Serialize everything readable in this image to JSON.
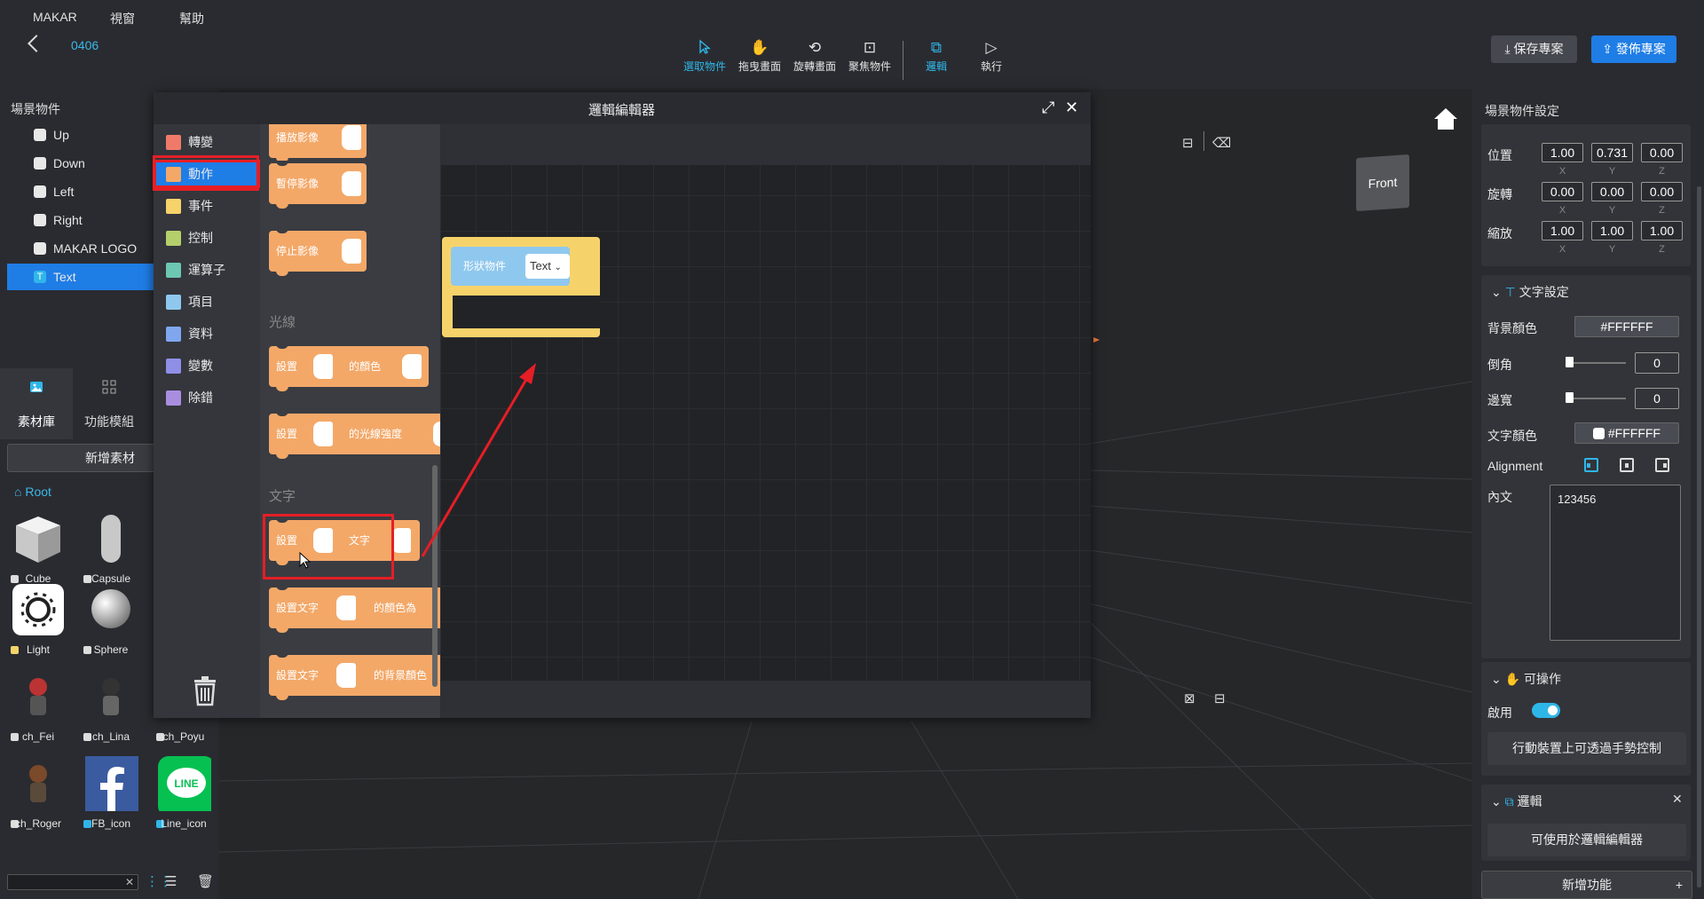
{
  "menu": [
    "MAKAR",
    "視窗",
    "幫助"
  ],
  "project_name": "0406",
  "toolbar": {
    "tools": [
      {
        "label": "選取物件",
        "icon": "cursor-icon",
        "active": true
      },
      {
        "label": "拖曳畫面",
        "icon": "hand-icon",
        "active": false
      },
      {
        "label": "旋轉畫面",
        "icon": "rotate-icon",
        "active": false
      },
      {
        "label": "聚焦物件",
        "icon": "focus-icon",
        "active": false
      },
      {
        "label": "邏輯",
        "icon": "logic-icon",
        "active": true
      },
      {
        "label": "執行",
        "icon": "play-icon",
        "active": false
      }
    ],
    "save_label": "保存專案",
    "publish_label": "發佈專案"
  },
  "scene": {
    "title": "場景物件",
    "items": [
      {
        "label": "Up"
      },
      {
        "label": "Down"
      },
      {
        "label": "Left"
      },
      {
        "label": "Right"
      },
      {
        "label": "MAKAR LOGO"
      },
      {
        "label": "Text",
        "selected": true
      }
    ],
    "tabs": [
      "素材庫",
      "功能模組"
    ],
    "add_asset": "新增素材",
    "root_label": "Root",
    "assets": [
      {
        "label": "Cube"
      },
      {
        "label": "Capsule"
      },
      {
        "label": "Light"
      },
      {
        "label": "Sphere"
      },
      {
        "label": "ch_Fei"
      },
      {
        "label": "ch_Lina"
      },
      {
        "label": "ch_Poyu"
      },
      {
        "label": "ch_Roger"
      },
      {
        "label": "FB_icon"
      },
      {
        "label": "Line_icon"
      }
    ]
  },
  "viewport": {
    "cube_label": "Front"
  },
  "logic_editor": {
    "title": "邏輯編輯器",
    "categories": [
      {
        "label": "轉變",
        "color": "#f07a6a"
      },
      {
        "label": "動作",
        "color": "#f3a868",
        "selected": true
      },
      {
        "label": "事件",
        "color": "#f6d36a"
      },
      {
        "label": "控制",
        "color": "#b5cf6b"
      },
      {
        "label": "運算子",
        "color": "#6cc7b3"
      },
      {
        "label": "項目",
        "color": "#8fc8ee"
      },
      {
        "label": "資料",
        "color": "#7fa6ee"
      },
      {
        "label": "變數",
        "color": "#8f8fe8"
      },
      {
        "label": "除錯",
        "color": "#a98ee0"
      }
    ],
    "blocks": {
      "play_video": "播放影像",
      "pause_video": "暫停影像",
      "stop_video": "停止影像",
      "light_section": "光線",
      "set_color_a": "設置",
      "set_color_b": "的顏色",
      "set_intensity_a": "設置",
      "set_intensity_b": "的光線強度",
      "text_section": "文字",
      "set_text_a": "設置",
      "set_text_b": "文字",
      "set_text_color_a": "設置文字",
      "set_text_color_b": "的顏色為",
      "set_text_bg_a": "設置文字",
      "set_text_bg_b": "的背景顏色"
    },
    "workspace_block": {
      "label": "形狀物件",
      "select_value": "Text"
    }
  },
  "props": {
    "title": "場景物件設定",
    "position_label": "位置",
    "rotation_label": "旋轉",
    "scale_label": "縮放",
    "position": [
      "1.00",
      "0.731",
      "0.00"
    ],
    "rotation": [
      "0.00",
      "0.00",
      "0.00"
    ],
    "scale": [
      "1.00",
      "1.00",
      "1.00"
    ],
    "axes": [
      "X",
      "Y",
      "Z"
    ],
    "text_settings": {
      "header": "文字設定",
      "bg_color_label": "背景顏色",
      "bg_color": "#FFFFFF",
      "radius_label": "倒角",
      "radius": "0",
      "border_label": "邊寬",
      "border": "0",
      "text_color_label": "文字顏色",
      "text_color": "#FFFFFF",
      "alignment_label": "Alignment",
      "content_label": "內文",
      "content": "123456"
    },
    "interactive": {
      "header": "可操作",
      "enable_label": "啟用",
      "gesture_button": "行動裝置上可透過手勢控制"
    },
    "logic": {
      "header": "邏輯",
      "editor_button": "可使用於邏輯編輯器"
    },
    "add_function": "新增功能"
  }
}
